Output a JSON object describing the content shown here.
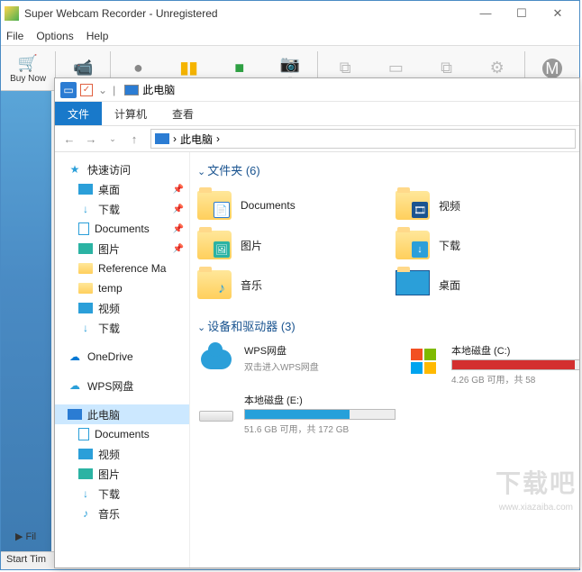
{
  "app": {
    "title": "Super Webcam Recorder - Unregistered",
    "menus": [
      "File",
      "Options",
      "Help"
    ],
    "toolbar": {
      "buy": "Buy Now",
      "buttons": [
        "Buy Now",
        "Webcam",
        "Record",
        "Pause",
        "Stop",
        "Snapshot",
        "",
        "Copy",
        "",
        "",
        "Settings",
        "",
        "About"
      ]
    },
    "status": {
      "left": "Start Tim",
      "fil": "Fil"
    }
  },
  "explorer": {
    "title": "此电脑",
    "ribbon": {
      "file": "文件",
      "computer": "计算机",
      "view": "查看"
    },
    "address": {
      "root": "此电脑",
      "sep": "›"
    },
    "nav": {
      "quick": "快速访问",
      "items": [
        {
          "id": "desktop",
          "label": "桌面",
          "pin": true
        },
        {
          "id": "downloads",
          "label": "下载",
          "pin": true
        },
        {
          "id": "documents",
          "label": "Documents",
          "pin": true
        },
        {
          "id": "pictures",
          "label": "图片",
          "pin": true
        },
        {
          "id": "refma",
          "label": "Reference Ma",
          "pin": false
        },
        {
          "id": "temp",
          "label": "temp",
          "pin": false
        },
        {
          "id": "videos",
          "label": "视频",
          "pin": false
        },
        {
          "id": "downloads2",
          "label": "下载",
          "pin": false
        }
      ],
      "onedrive": "OneDrive",
      "wps": "WPS网盘",
      "thispc": "此电脑",
      "pcitems": [
        {
          "id": "documents",
          "label": "Documents"
        },
        {
          "id": "videos",
          "label": "视频"
        },
        {
          "id": "pictures",
          "label": "图片"
        },
        {
          "id": "downloads",
          "label": "下载"
        },
        {
          "id": "music",
          "label": "音乐"
        }
      ]
    },
    "groups": {
      "folders": {
        "header": "文件夹 (6)",
        "items": [
          {
            "id": "documents",
            "label": "Documents"
          },
          {
            "id": "videos",
            "label": "视频"
          },
          {
            "id": "pictures",
            "label": "图片"
          },
          {
            "id": "downloads",
            "label": "下载"
          },
          {
            "id": "music",
            "label": "音乐"
          },
          {
            "id": "desktop",
            "label": "桌面"
          }
        ]
      },
      "drives": {
        "header": "设备和驱动器 (3)",
        "items": [
          {
            "id": "wps",
            "name": "WPS网盘",
            "sub": "双击进入WPS网盘"
          },
          {
            "id": "c",
            "name": "本地磁盘 (C:)",
            "sub": "4.26 GB 可用，共 58",
            "fill": 93,
            "color": "red"
          },
          {
            "id": "e",
            "name": "本地磁盘 (E:)",
            "sub": "51.6 GB 可用，共 172 GB",
            "fill": 70,
            "color": "blue"
          }
        ]
      }
    }
  },
  "watermark": {
    "big": "下载吧",
    "url": "www.xiazaiba.com"
  }
}
